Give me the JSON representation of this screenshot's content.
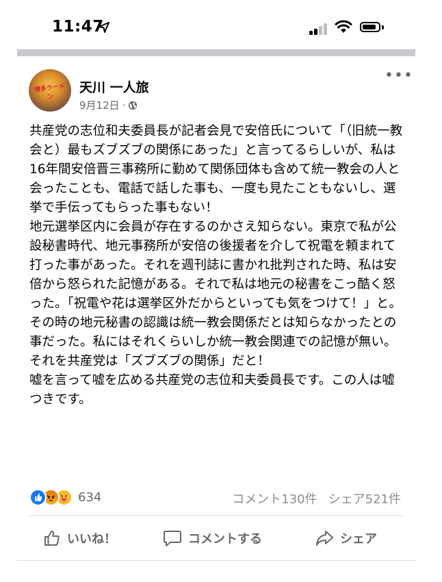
{
  "status_bar": {
    "time": "11:47"
  },
  "post": {
    "author": "天川 一人旅",
    "avatar_text": "博多ラーメン",
    "date": "9月12日",
    "separator": "·",
    "paragraphs": [
      "共産党の志位和夫委員長が記者会見で安倍氏について「（旧統一教会と）最もズブズブの関係にあった」と言ってるらしいが、私は16年間安倍晋三事務所に勤めて関係団体も含めて統一教会の人と会ったことも、電話で話した事も、一度も見たこともないし、選挙で手伝ってもらった事もない！",
      "地元選挙区内に会員が存在するのかさえ知らない。東京で私が公設秘書時代、地元事務所が安倍の後援者を介して祝電を頼まれて打った事があった。それを週刊誌に書かれ批判された時、私は安倍から怒られた記憶がある。それで私は地元の秘書をこっ酷く怒った。「祝電や花は選挙区外だからといっても気をつけて！」と。その時の地元秘書の認識は統一教会関係だとは知らなかったとの事だった。私にはそれくらいしか統一教会関連での記憶が無い。",
      "それを共産党は「ズブズブの関係」だと！",
      "嘘を言って嘘を広める共産党の志位和夫委員長です。この人は嘘つきです。"
    ],
    "reaction_count": "634",
    "comment_count": "コメント130件",
    "share_count": "シェア521件"
  },
  "actions": {
    "like": "いいね！",
    "comment": "コメントする",
    "share": "シェア"
  },
  "icons": {
    "reactions": [
      "like-icon",
      "angry-icon",
      "care-icon"
    ],
    "like_color": "#1877f2"
  }
}
